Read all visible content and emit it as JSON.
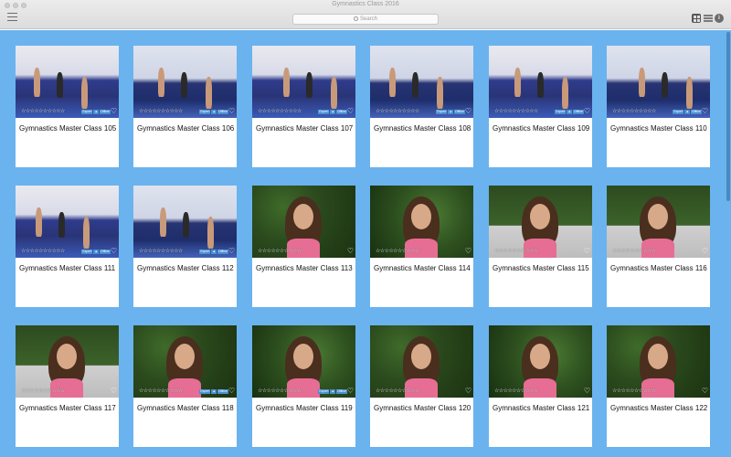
{
  "window": {
    "title": "Gymnastics Class 2016"
  },
  "search": {
    "placeholder": "Search"
  },
  "cards": [
    {
      "title": "Gymnastics Master Class 105",
      "stars": "☆☆☆☆☆☆☆☆☆☆",
      "tags": [
        "Expert",
        "▲",
        "Offline"
      ]
    },
    {
      "title": "Gymnastics Master Class 106",
      "stars": "☆☆☆☆☆☆☆☆☆☆",
      "tags": [
        "Expert",
        "▲",
        "Offline"
      ]
    },
    {
      "title": "Gymnastics Master Class 107",
      "stars": "☆☆☆☆☆☆☆☆☆☆",
      "tags": [
        "Expert",
        "▲",
        "Offline"
      ]
    },
    {
      "title": "Gymnastics Master Class 108",
      "stars": "☆☆☆☆☆☆☆☆☆☆",
      "tags": [
        "Expert",
        "▲",
        "Offline"
      ]
    },
    {
      "title": "Gymnastics Master Class 109",
      "stars": "☆☆☆☆☆☆☆☆☆☆",
      "tags": [
        "Expert",
        "▲",
        "Offline"
      ]
    },
    {
      "title": "Gymnastics Master Class 110",
      "stars": "☆☆☆☆☆☆☆☆☆☆",
      "tags": [
        "Expert",
        "▲",
        "Offline"
      ]
    },
    {
      "title": "Gymnastics Master Class 111",
      "stars": "☆☆☆☆☆☆☆☆☆☆",
      "tags": [
        "Expert",
        "▲",
        "Offline"
      ]
    },
    {
      "title": "Gymnastics Master Class 112",
      "stars": "☆☆☆☆☆☆☆☆☆☆",
      "tags": [
        "Expert",
        "▲",
        "Offline"
      ]
    },
    {
      "title": "Gymnastics Master Class 113",
      "stars": "☆☆☆☆☆☆☆☆☆☆",
      "tags": []
    },
    {
      "title": "Gymnastics Master Class 114",
      "stars": "☆☆☆☆☆☆☆☆☆☆",
      "tags": []
    },
    {
      "title": "Gymnastics Master Class 115",
      "stars": "☆☆☆☆☆☆☆☆☆☆",
      "tags": []
    },
    {
      "title": "Gymnastics Master Class 116",
      "stars": "☆☆☆☆☆☆☆☆☆☆",
      "tags": []
    },
    {
      "title": "Gymnastics Master Class 117",
      "stars": "☆☆☆☆☆☆☆☆☆☆",
      "tags": []
    },
    {
      "title": "Gymnastics Master Class 118",
      "stars": "☆☆☆☆☆☆☆☆☆☆",
      "tags": [
        "Expert",
        "▲",
        "Offline"
      ]
    },
    {
      "title": "Gymnastics Master Class 119",
      "stars": "☆☆☆☆☆☆☆☆☆☆",
      "tags": [
        "Expert",
        "▲",
        "Offline"
      ]
    },
    {
      "title": "Gymnastics Master Class 120",
      "stars": "☆☆☆☆☆☆☆☆☆☆",
      "tags": []
    },
    {
      "title": "Gymnastics Master Class 121",
      "stars": "☆☆☆☆☆☆☆☆☆☆",
      "tags": []
    },
    {
      "title": "Gymnastics Master Class 122",
      "stars": "☆☆☆☆☆☆☆☆☆☆",
      "tags": []
    }
  ],
  "colors": {
    "background": "#6ab3ef",
    "card": "#ffffff",
    "tag": "#4a8fd1"
  }
}
